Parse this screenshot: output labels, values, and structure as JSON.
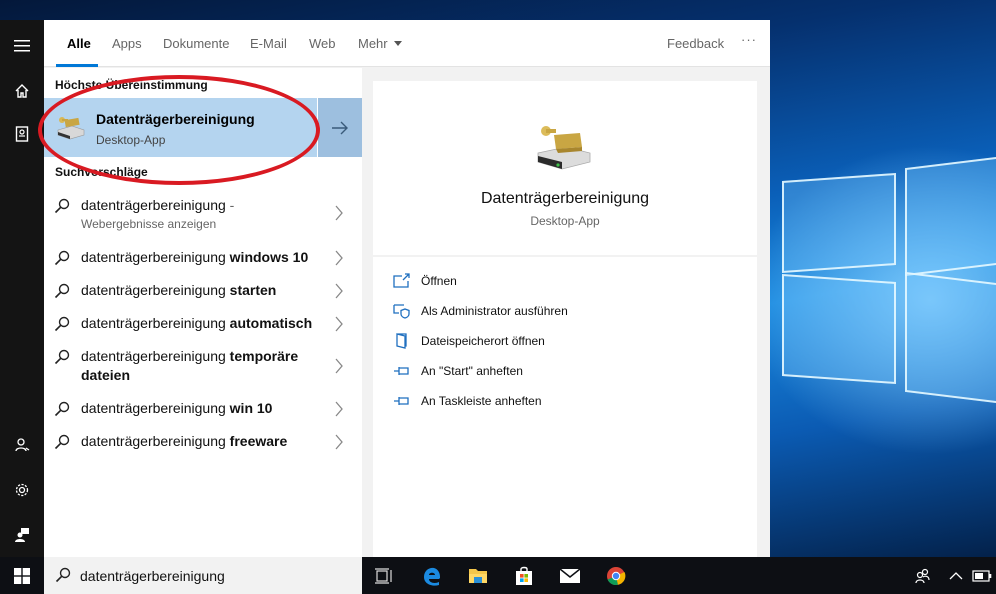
{
  "tabs": [
    {
      "label": "Alle",
      "active": true
    },
    {
      "label": "Apps"
    },
    {
      "label": "Dokumente"
    },
    {
      "label": "E-Mail"
    },
    {
      "label": "Web"
    },
    {
      "label": "Mehr"
    }
  ],
  "header": {
    "feedback_label": "Feedback",
    "more_label": "···"
  },
  "best_match": {
    "section_title": "Höchste Übereinstimmung",
    "name": "Datenträgerbereinigung",
    "type": "Desktop-App"
  },
  "suggestions": {
    "section_title": "Suchvorschläge",
    "items": [
      {
        "prefix": "datenträgerbereinigung",
        "bold": "",
        "suffix": " -",
        "sub": "Webergebnisse anzeigen"
      },
      {
        "prefix": "datenträgerbereinigung ",
        "bold": "windows 10"
      },
      {
        "prefix": "datenträgerbereinigung ",
        "bold": "starten"
      },
      {
        "prefix": "datenträgerbereinigung ",
        "bold": "automatisch"
      },
      {
        "prefix": "datenträgerbereinigung ",
        "bold": "temporäre dateien"
      },
      {
        "prefix": "datenträgerbereinigung ",
        "bold": "win 10"
      },
      {
        "prefix": "datenträgerbereinigung ",
        "bold": "freeware"
      }
    ]
  },
  "detail": {
    "name": "Datenträgerbereinigung",
    "type": "Desktop-App",
    "actions": [
      {
        "label": "Öffnen",
        "icon": "open-icon"
      },
      {
        "label": "Als Administrator ausführen",
        "icon": "admin-shield-icon"
      },
      {
        "label": "Dateispeicherort öffnen",
        "icon": "file-location-icon"
      },
      {
        "label": "An \"Start\" anheften",
        "icon": "pin-icon"
      },
      {
        "label": "An Taskleiste anheften",
        "icon": "pin-icon"
      }
    ]
  },
  "search": {
    "value": "datenträgerbereinigung"
  },
  "colors": {
    "accent": "#0078d7",
    "best_match_bg": "#b4d4ef",
    "annotation": "#d91a22"
  }
}
